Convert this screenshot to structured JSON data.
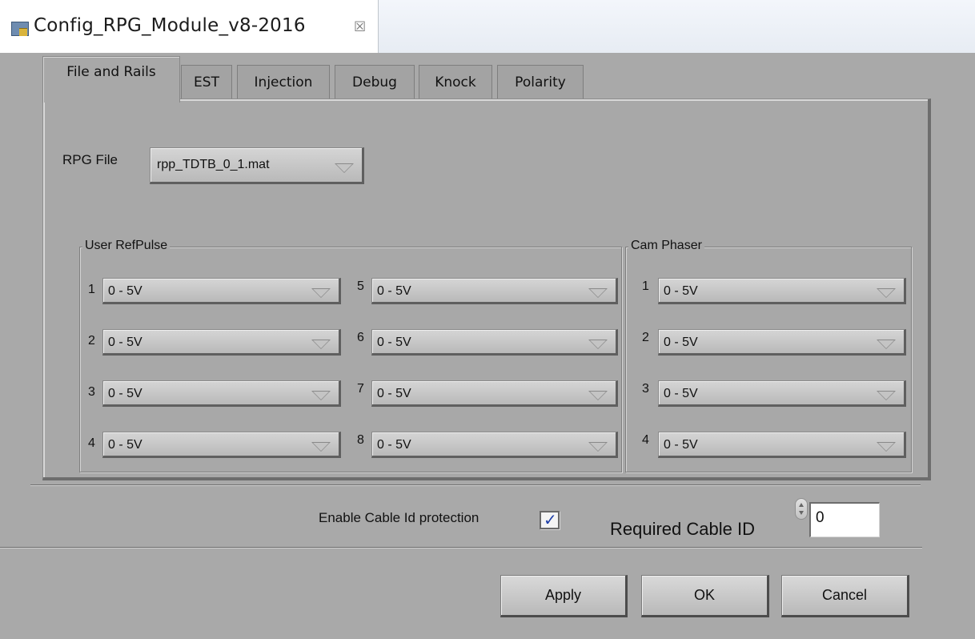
{
  "editor_tab": {
    "title": "Config_RPG_Module_v8-2016",
    "close_glyph": "☒",
    "icon": "module-icon"
  },
  "tabs": [
    {
      "label": "File and Rails",
      "active": true
    },
    {
      "label": "EST",
      "active": false
    },
    {
      "label": "Injection",
      "active": false
    },
    {
      "label": "Debug",
      "active": false
    },
    {
      "label": "Knock",
      "active": false
    },
    {
      "label": "Polarity",
      "active": false
    }
  ],
  "rpg_file": {
    "label": "RPG File",
    "value": "rpp_TDTB_0_1.mat"
  },
  "user_refpulse": {
    "title": "User RefPulse",
    "rows": [
      {
        "num": "1",
        "value": "0 - 5V"
      },
      {
        "num": "2",
        "value": "0 - 5V"
      },
      {
        "num": "3",
        "value": "0 - 5V"
      },
      {
        "num": "4",
        "value": "0 - 5V"
      },
      {
        "num": "5",
        "value": "0 - 5V"
      },
      {
        "num": "6",
        "value": "0 - 5V"
      },
      {
        "num": "7",
        "value": "0 - 5V"
      },
      {
        "num": "8",
        "value": "0 - 5V"
      }
    ]
  },
  "cam_phaser": {
    "title": "Cam Phaser",
    "rows": [
      {
        "num": "1",
        "value": "0 - 5V"
      },
      {
        "num": "2",
        "value": "0 - 5V"
      },
      {
        "num": "3",
        "value": "0 - 5V"
      },
      {
        "num": "4",
        "value": "0 - 5V"
      }
    ]
  },
  "cable": {
    "enable_label": "Enable Cable Id protection",
    "enabled": true,
    "check_glyph": "✓",
    "required_label": "Required Cable ID",
    "required_value": "0"
  },
  "buttons": {
    "apply": "Apply",
    "ok": "OK",
    "cancel": "Cancel"
  }
}
